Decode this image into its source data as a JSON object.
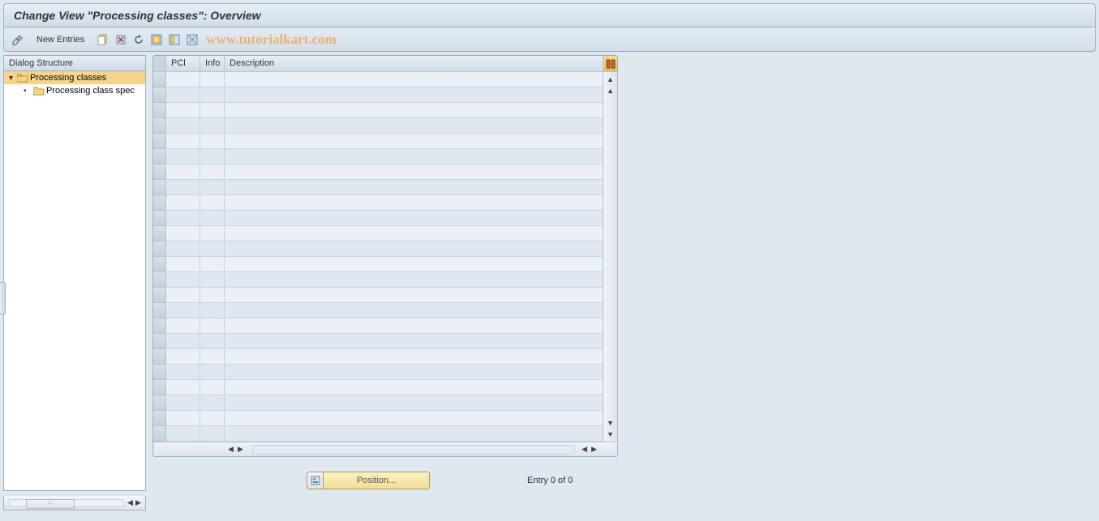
{
  "title": "Change View \"Processing classes\": Overview",
  "toolbar": {
    "new_entries": "New Entries"
  },
  "watermark": "www.tutorialkart.com",
  "left_panel": {
    "header": "Dialog Structure",
    "tree": {
      "root_label": "Processing classes",
      "child_label": "Processing class spec"
    }
  },
  "table": {
    "columns": {
      "pcl": "PCl",
      "info": "Info",
      "desc": "Description"
    }
  },
  "footer": {
    "position_label": "Position...",
    "entry_text": "Entry 0 of 0"
  }
}
